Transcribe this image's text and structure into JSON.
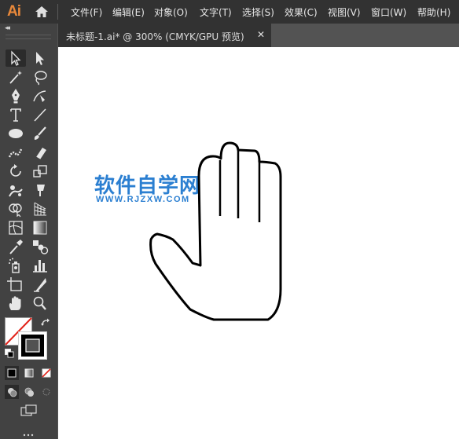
{
  "app": {
    "logo_text": "Ai"
  },
  "menu": {
    "items": [
      "文件(F)",
      "编辑(E)",
      "对象(O)",
      "文字(T)",
      "选择(S)",
      "效果(C)",
      "视图(V)",
      "窗口(W)",
      "帮助(H)"
    ]
  },
  "toolbar": {
    "collapse_glyph": "◂◂",
    "tools": [
      "selection",
      "direct-selection",
      "magic-wand",
      "lasso",
      "pen",
      "curvature",
      "type",
      "line-segment",
      "ellipse",
      "paintbrush",
      "shaper",
      "eraser",
      "rotate",
      "scale",
      "puppet-warp",
      "free-transform",
      "shape-builder",
      "perspective-grid",
      "mesh",
      "gradient",
      "eyedropper",
      "blend",
      "symbol-sprayer",
      "column-graph",
      "artboard",
      "slice",
      "hand",
      "zoom"
    ],
    "fill_color": "#ffffff",
    "stroke_color": "#000000"
  },
  "document_tab": {
    "title": "未标题-1.ai* @ 300% (CMYK/GPU 预览)",
    "close_glyph": "✕"
  },
  "canvas": {
    "watermark_title": "软件自学网",
    "watermark_url": "WWW.RJZXW.COM",
    "watermark_color": "#2b7fd1",
    "artwork": "hand-outline"
  },
  "colors": {
    "menubar_bg": "#323232",
    "panel_bg": "#424242",
    "workspace_bg": "#535353",
    "accent_orange": "#E8883A"
  }
}
